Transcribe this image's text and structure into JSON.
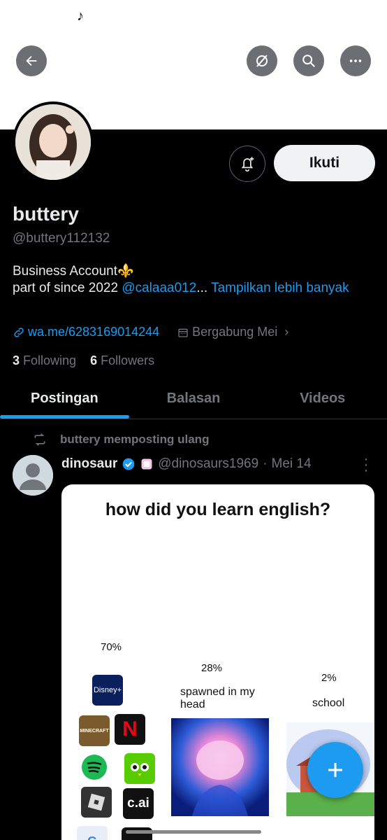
{
  "header": {
    "back_icon": "arrow-left-icon",
    "grok_icon": "grok-icon",
    "search_icon": "search-icon",
    "more_icon": "more-horizontal-icon"
  },
  "profile": {
    "name": "buttery",
    "handle": "@buttery112132",
    "bio_line1": "Business Account⚜️",
    "bio_line2_prefix": "part of  since 2022 ",
    "bio_mention": "@calaaa012",
    "bio_ellipsis": "...",
    "show_more": "Tampilkan lebih banyak",
    "website": "wa.me/6283169014244",
    "joined": "Bergabung Mei",
    "following_count": "3",
    "following_label": "Following",
    "followers_count": "6",
    "followers_label": "Followers",
    "follow_button": "Ikuti"
  },
  "tabs": [
    {
      "label": "Postingan",
      "active": true
    },
    {
      "label": "Balasan",
      "active": false
    },
    {
      "label": "Videos",
      "active": false
    }
  ],
  "post": {
    "repost_label": "buttery memposting ulang",
    "author_name": "dinosaur",
    "author_handle": "@dinosaurs1969",
    "date": "Mei 14",
    "separator": "·",
    "media": {
      "title": "how did you learn english?",
      "col1_pct": "70%",
      "col2_pct": "28%",
      "col2_caption": "spawned in my head",
      "col3_pct": "2%",
      "col3_caption": "school",
      "apps": [
        "Disney+",
        "MINECRAFT",
        "N",
        "c.ai"
      ]
    }
  },
  "colors": {
    "accent": "#1d9bf0",
    "background": "#000000",
    "muted": "#71767b"
  }
}
